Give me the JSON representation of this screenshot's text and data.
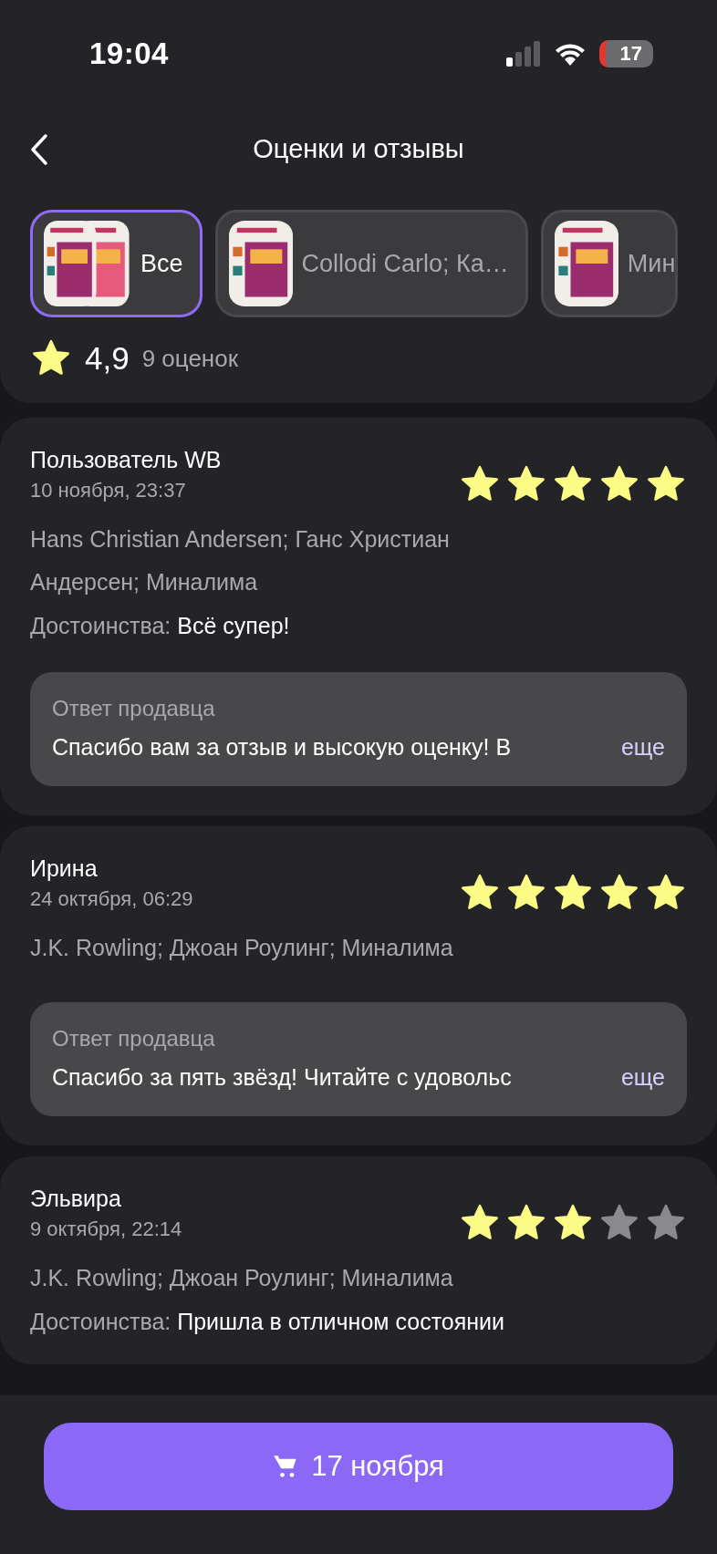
{
  "status_bar": {
    "time": "19:04",
    "battery": "17"
  },
  "header": {
    "title": "Оценки и отзывы"
  },
  "filters": [
    {
      "label": "Все",
      "selected": true,
      "kind": "pair"
    },
    {
      "label": "Collodi Carlo; Ка…",
      "selected": false,
      "kind": "single"
    },
    {
      "label": "Мин",
      "selected": false,
      "kind": "single"
    }
  ],
  "summary": {
    "rating": "4,9",
    "count": "9 оценок"
  },
  "reviews": [
    {
      "author": "Пользователь WB",
      "date": "10 ноября, 23:37",
      "stars": 5,
      "product": "Hans Christian Andersen; Ганс Христиан Андерсен; Миналима",
      "pros_label": "Достоинства:",
      "pros": "Всё супер!",
      "reply": {
        "title": "Ответ продавца",
        "text": "Спасибо вам за отзыв и высокую оценку! В",
        "more": "еще"
      }
    },
    {
      "author": "Ирина",
      "date": "24 октября, 06:29",
      "stars": 5,
      "product": "J.K. Rowling; Джоан Роулинг; Миналима",
      "reply": {
        "title": "Ответ продавца",
        "text": "Спасибо за пять звёзд! Читайте с удовольс",
        "more": "еще"
      }
    },
    {
      "author": "Эльвира",
      "date": "9 октября, 22:14",
      "stars": 3,
      "product": "J.K. Rowling; Джоан Роулинг; Миналима",
      "pros_label": "Достоинства:",
      "pros": "Пришла в отличном состоянии"
    }
  ],
  "buy_button": {
    "label": "17 ноября"
  }
}
